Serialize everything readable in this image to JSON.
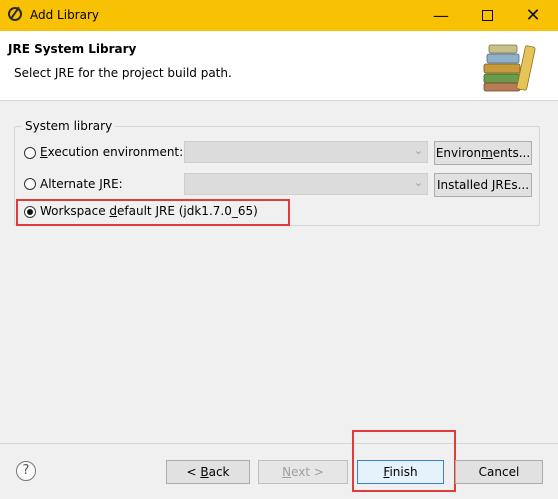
{
  "window": {
    "title": "Add Library",
    "controls": {
      "minimize": "—",
      "maximize": "",
      "close": "✕"
    }
  },
  "header": {
    "title": "JRE System Library",
    "description": "Select JRE for the project build path."
  },
  "system_library": {
    "group_label": "System library",
    "options": [
      {
        "pre": "",
        "mn": "E",
        "post": "xecution environment:",
        "checked": false
      },
      {
        "pre": "Alternate ",
        "mn": "J",
        "post": "RE:",
        "checked": false
      },
      {
        "pre": "Workspace ",
        "mn": "d",
        "post": "efault JRE (jdk1.7.0_65)",
        "checked": true
      }
    ],
    "environments_button": {
      "pre": "Environ",
      "mn": "m",
      "post": "ents..."
    },
    "installed_jres_button": {
      "pre": "Installed JREs",
      "mn": "",
      "post": "..."
    }
  },
  "footer": {
    "help_icon": "?",
    "back": {
      "pre": "< ",
      "mn": "B",
      "post": "ack"
    },
    "next": {
      "pre": "",
      "mn": "N",
      "post": "ext >"
    },
    "finish": {
      "pre": "",
      "mn": "F",
      "post": "inish"
    },
    "cancel": "Cancel"
  },
  "colors": {
    "titlebar": "#f9c104",
    "highlight": "#e03c3c",
    "default_button_border": "#3c7fd5"
  }
}
